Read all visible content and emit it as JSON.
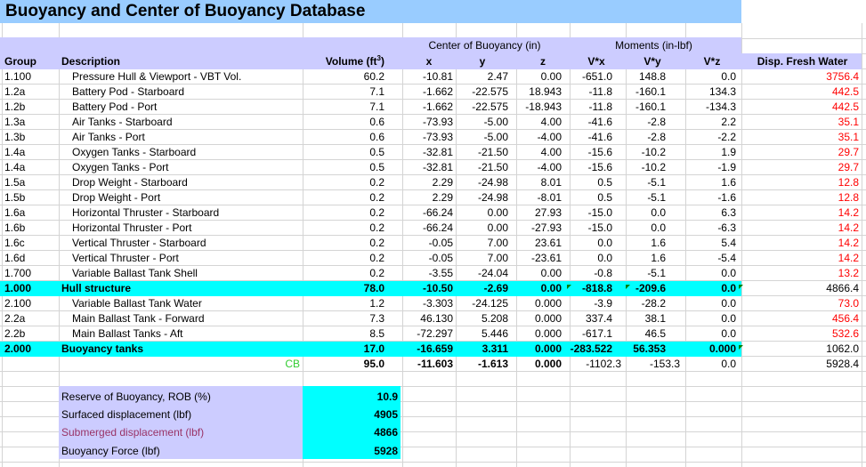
{
  "title": "Buoyancy and Center of Buoyancy Database",
  "headers": {
    "cob_group": "Center of Buoyancy (in)",
    "moments_group": "Moments (in-lbf)",
    "group": "Group",
    "description": "Description",
    "volume": "Volume (ft³)",
    "x": "x",
    "y": "y",
    "z": "z",
    "vx": "V*x",
    "vy": "V*y",
    "vz": "V*z",
    "disp": "Disp. Fresh Water"
  },
  "rows": [
    {
      "group": "1.100",
      "desc": "Pressure Hull & Viewport - VBT Vol.",
      "vol": "60.2",
      "x": "-10.81",
      "y": "2.47",
      "z": "0.00",
      "vx": "-651.0",
      "vy": "148.8",
      "vz": "0.0",
      "disp": "3756.4"
    },
    {
      "group": "1.2a",
      "desc": "Battery Pod - Starboard",
      "vol": "7.1",
      "x": "-1.662",
      "y": "-22.575",
      "z": "18.943",
      "vx": "-11.8",
      "vy": "-160.1",
      "vz": "134.3",
      "disp": "442.5"
    },
    {
      "group": "1.2b",
      "desc": "Battery Pod - Port",
      "vol": "7.1",
      "x": "-1.662",
      "y": "-22.575",
      "z": "-18.943",
      "vx": "-11.8",
      "vy": "-160.1",
      "vz": "-134.3",
      "disp": "442.5"
    },
    {
      "group": "1.3a",
      "desc": "Air Tanks -  Starboard",
      "vol": "0.6",
      "x": "-73.93",
      "y": "-5.00",
      "z": "4.00",
      "vx": "-41.6",
      "vy": "-2.8",
      "vz": "2.2",
      "disp": "35.1"
    },
    {
      "group": "1.3b",
      "desc": "Air Tanks -  Port",
      "vol": "0.6",
      "x": "-73.93",
      "y": "-5.00",
      "z": "-4.00",
      "vx": "-41.6",
      "vy": "-2.8",
      "vz": "-2.2",
      "disp": "35.1"
    },
    {
      "group": "1.4a",
      "desc": "Oxygen Tanks - Starboard",
      "vol": "0.5",
      "x": "-32.81",
      "y": "-21.50",
      "z": "4.00",
      "vx": "-15.6",
      "vy": "-10.2",
      "vz": "1.9",
      "disp": "29.7"
    },
    {
      "group": "1.4a",
      "desc": "Oxygen Tanks - Port",
      "vol": "0.5",
      "x": "-32.81",
      "y": "-21.50",
      "z": "-4.00",
      "vx": "-15.6",
      "vy": "-10.2",
      "vz": "-1.9",
      "disp": "29.7"
    },
    {
      "group": "1.5a",
      "desc": "Drop Weight - Starboard",
      "vol": "0.2",
      "x": "2.29",
      "y": "-24.98",
      "z": "8.01",
      "vx": "0.5",
      "vy": "-5.1",
      "vz": "1.6",
      "disp": "12.8"
    },
    {
      "group": "1.5b",
      "desc": "Drop Weight - Port",
      "vol": "0.2",
      "x": "2.29",
      "y": "-24.98",
      "z": "-8.01",
      "vx": "0.5",
      "vy": "-5.1",
      "vz": "-1.6",
      "disp": "12.8"
    },
    {
      "group": "1.6a",
      "desc": "Horizontal Thruster - Starboard",
      "vol": "0.2",
      "x": "-66.24",
      "y": "0.00",
      "z": "27.93",
      "vx": "-15.0",
      "vy": "0.0",
      "vz": "6.3",
      "disp": "14.2"
    },
    {
      "group": "1.6b",
      "desc": "Horizontal Thruster - Port",
      "vol": "0.2",
      "x": "-66.24",
      "y": "0.00",
      "z": "-27.93",
      "vx": "-15.0",
      "vy": "0.0",
      "vz": "-6.3",
      "disp": "14.2"
    },
    {
      "group": "1.6c",
      "desc": "Vertical Thruster - Starboard",
      "vol": "0.2",
      "x": "-0.05",
      "y": "7.00",
      "z": "23.61",
      "vx": "0.0",
      "vy": "1.6",
      "vz": "5.4",
      "disp": "14.2"
    },
    {
      "group": "1.6d",
      "desc": "Vertical Thruster - Port",
      "vol": "0.2",
      "x": "-0.05",
      "y": "7.00",
      "z": "-23.61",
      "vx": "0.0",
      "vy": "1.6",
      "vz": "-5.4",
      "disp": "14.2"
    },
    {
      "group": "1.700",
      "desc": "Variable Ballast Tank Shell",
      "vol": "0.2",
      "x": "-3.55",
      "y": "-24.04",
      "z": "0.00",
      "vx": "-0.8",
      "vy": "-5.1",
      "vz": "0.0",
      "disp": "13.2"
    }
  ],
  "hull_total": {
    "group": "1.000",
    "desc": "Hull structure",
    "vol": "78.0",
    "x": "-10.50",
    "y": "-2.69",
    "z": "0.00",
    "vx": "-818.8",
    "vy": "-209.6",
    "vz": "0.0",
    "disp": "4866.4"
  },
  "rows2": [
    {
      "group": "2.100",
      "desc": "Variable Ballast Tank Water",
      "vol": "1.2",
      "x": "-3.303",
      "y": "-24.125",
      "z": "0.000",
      "vx": "-3.9",
      "vy": "-28.2",
      "vz": "0.0",
      "disp": "73.0"
    },
    {
      "group": "2.2a",
      "desc": "Main Ballast Tank - Forward",
      "vol": "7.3",
      "x": "46.130",
      "y": "5.208",
      "z": "0.000",
      "vx": "337.4",
      "vy": "38.1",
      "vz": "0.0",
      "disp": "456.4"
    },
    {
      "group": "2.2b",
      "desc": "Main Ballast Tanks - Aft",
      "vol": "8.5",
      "x": "-72.297",
      "y": "5.446",
      "z": "0.000",
      "vx": "-617.1",
      "vy": "46.5",
      "vz": "0.0",
      "disp": "532.6"
    }
  ],
  "buoy_total": {
    "group": "2.000",
    "desc": "Buoyancy tanks",
    "vol": "17.0",
    "x": "-16.659",
    "y": "3.311",
    "z": "0.000",
    "vx": "-283.522",
    "vy": "56.353",
    "vz": "0.000",
    "disp": "1062.0"
  },
  "cb": {
    "label": "CB",
    "vol": "95.0",
    "x": "-11.603",
    "y": "-1.613",
    "z": "0.000",
    "vx": "-1102.3",
    "vy": "-153.3",
    "vz": "0.0",
    "disp": "5928.4"
  },
  "summary": [
    {
      "label": "Reserve of Buoyancy, ROB (%)",
      "value": "10.9"
    },
    {
      "label": "Surfaced displacement (lbf)",
      "value": "4905"
    },
    {
      "label": "Submerged displacement (lbf)",
      "value": "4866"
    },
    {
      "label": "Buoyancy Force (lbf)",
      "value": "5928"
    }
  ],
  "colors": {
    "title_bg": "#99ccff",
    "header_bg": "#ccccff",
    "total_bg": "#00ffff",
    "red_text": "#ff0000",
    "cb_text": "#33cc33",
    "grid": "#c0c0c0"
  }
}
